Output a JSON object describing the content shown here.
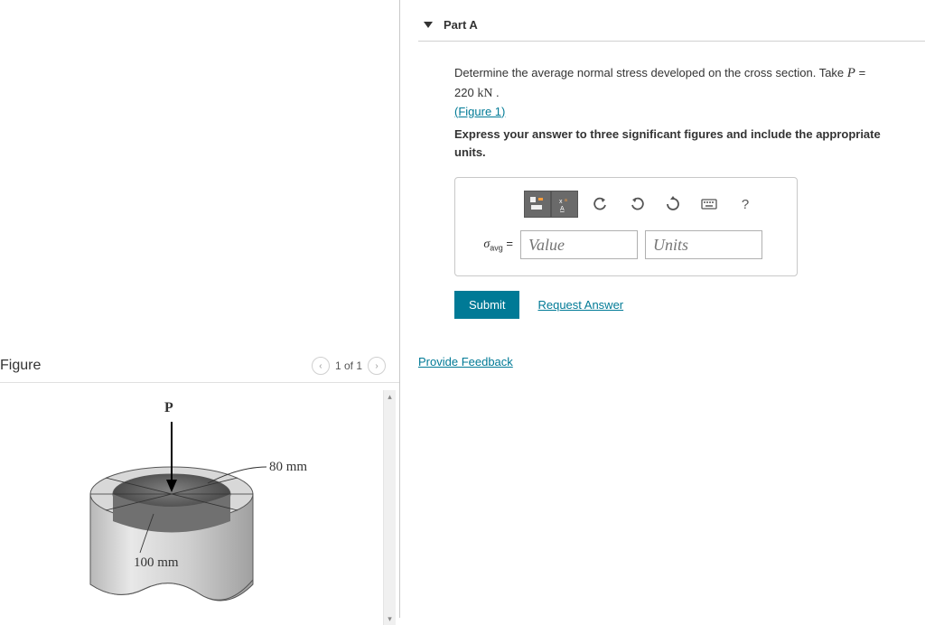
{
  "figure": {
    "title": "Figure",
    "pager": "1 of 1",
    "label_P": "P",
    "dim_inner": "80 mm",
    "dim_outer": "100 mm"
  },
  "part": {
    "label": "Part A",
    "question_prefix": "Determine the average normal stress developed on the cross section. Take ",
    "pvar": "P",
    "eq": " = 220 ",
    "unit": "kN",
    "period": " .",
    "fig_link": "(Figure 1)",
    "instruction": "Express your answer to three significant figures and include the appropriate units.",
    "lhs_sym": "σ",
    "lhs_sub": "avg",
    "lhs_eq": " =",
    "value_ph": "Value",
    "units_ph": "Units",
    "submit": "Submit",
    "request": "Request Answer",
    "help": "?"
  },
  "feedback": {
    "label": "Provide Feedback"
  }
}
